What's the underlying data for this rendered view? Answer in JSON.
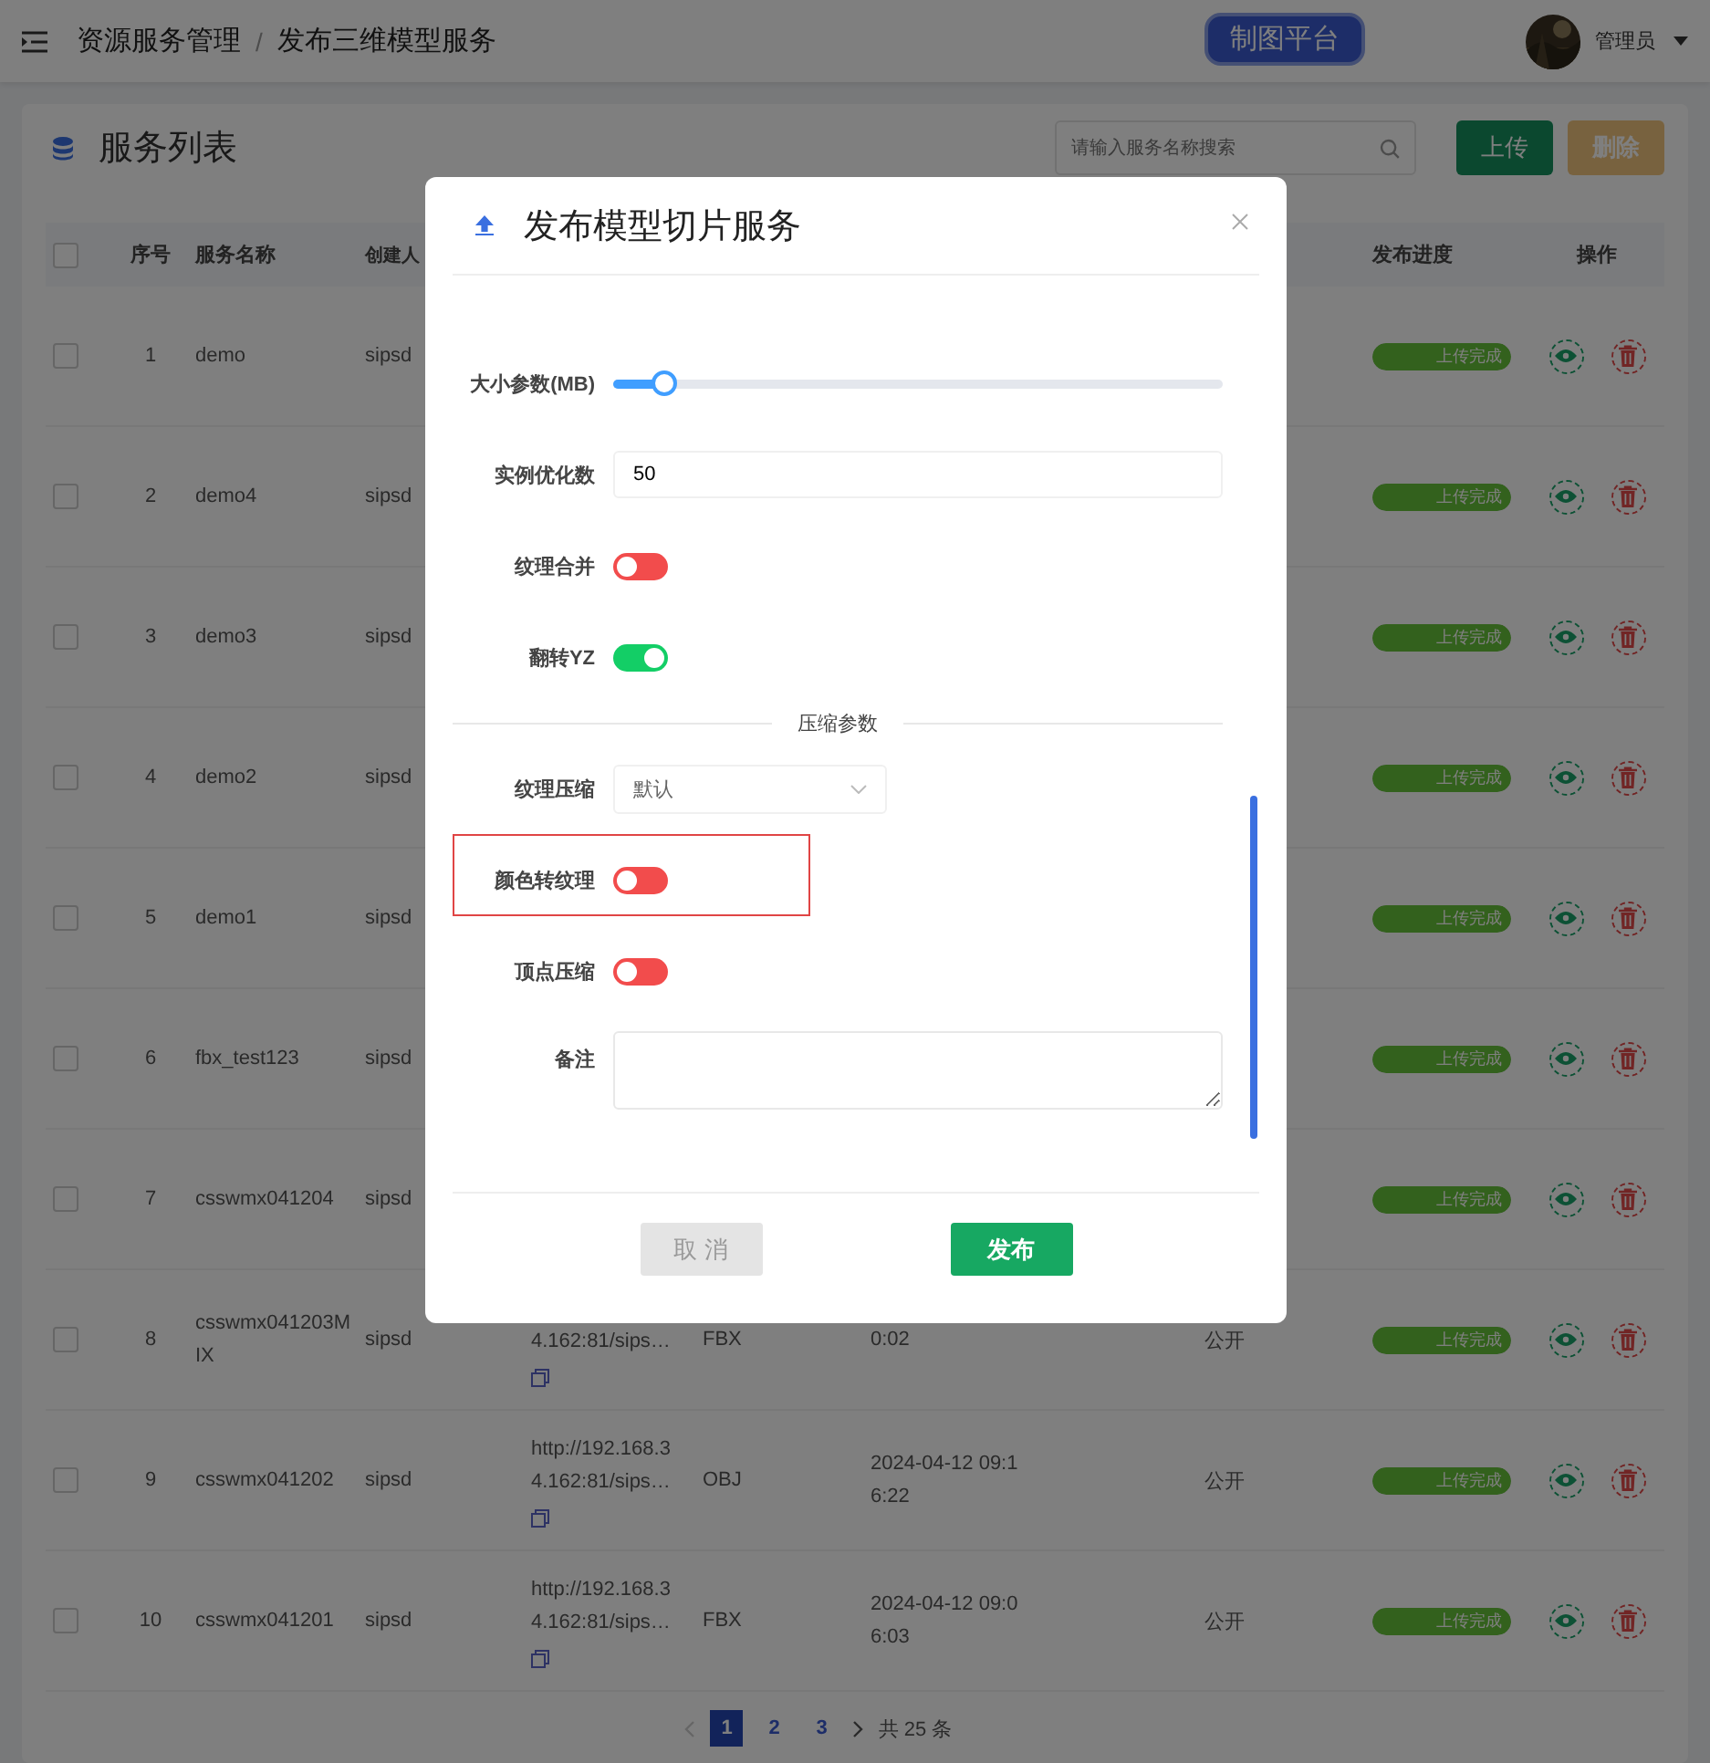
{
  "header": {
    "breadcrumb": [
      "资源服务管理",
      "发布三维模型服务"
    ],
    "separator": "/",
    "badge": "制图平台",
    "user": "管理员"
  },
  "list": {
    "title": "服务列表",
    "search": {
      "placeholder": "请输入服务名称搜索"
    },
    "buttons": [
      {
        "label": "上传",
        "disabled": false
      },
      {
        "label": "删除",
        "disabled": true
      }
    ],
    "select_all_checked": false,
    "headers_left": [
      "序号",
      "服务名称",
      "创建人"
    ],
    "headers_right": [
      "发布进度",
      "操作"
    ],
    "rows": [
      {
        "no": "1",
        "name": "demo",
        "creator": "sipsd",
        "checked": false,
        "progress": {
          "level": 1,
          "text": "上传完成"
        }
      },
      {
        "no": "2",
        "name": "demo4",
        "creator": "sipsd",
        "checked": false,
        "progress": {
          "level": 1,
          "text": "上传完成"
        }
      },
      {
        "no": "3",
        "name": "demo3",
        "creator": "sipsd",
        "checked": false,
        "progress": {
          "level": 1,
          "text": "上传完成"
        }
      },
      {
        "no": "4",
        "name": "demo2",
        "creator": "sipsd",
        "checked": false,
        "progress": {
          "level": 1,
          "text": "上传完成"
        }
      },
      {
        "no": "5",
        "name": "demo1",
        "creator": "sipsd",
        "checked": false,
        "progress": {
          "level": 1,
          "text": "上传完成"
        }
      },
      {
        "no": "6",
        "name": "fbx_test123",
        "creator": "sipsd",
        "checked": false,
        "progress": {
          "level": 1,
          "text": "上传完成"
        }
      },
      {
        "no": "7",
        "name": "csswmx041204",
        "creator": "sipsd",
        "checked": false,
        "progress": {
          "level": 1,
          "text": "上传完成"
        }
      },
      {
        "no": "8",
        "name": "csswmx041203MIX",
        "creator": "sipsd",
        "checked": false,
        "url": "4.162:81/sips…",
        "type": "FBX",
        "date": "0:02",
        "access": "公开",
        "progress": {
          "level": 1,
          "text": "上传完成"
        }
      },
      {
        "no": "9",
        "name": "csswmx041202",
        "creator": "sipsd",
        "checked": false,
        "url": "http://192.168.34.162:81/sips…",
        "type": "OBJ",
        "date": "2024-04-12 09:16:22",
        "access": "公开",
        "progress": {
          "level": 1,
          "text": "上传完成"
        }
      },
      {
        "no": "10",
        "name": "csswmx041201",
        "creator": "sipsd",
        "checked": false,
        "url": "http://192.168.34.162:81/sips…",
        "type": "FBX",
        "date": "2024-04-12 09:06:03",
        "access": "公开",
        "progress": {
          "level": 1,
          "text": "上传完成"
        }
      }
    ],
    "pagination": {
      "pages": [
        {
          "label": "1",
          "selected": true
        },
        {
          "label": "2",
          "selected": false
        },
        {
          "label": "3",
          "selected": false
        }
      ],
      "total": "共 25 条"
    }
  },
  "dialog": {
    "title": "发布模型切片服务",
    "fields": [
      {
        "kind": "slider",
        "label": "大小参数(MB)",
        "level": 0.08
      },
      {
        "kind": "input",
        "label": "实例优化数",
        "value": "50"
      },
      {
        "kind": "switch",
        "label": "纹理合并",
        "on": false
      },
      {
        "kind": "switch",
        "label": "翻转YZ",
        "on": true
      },
      {
        "kind": "divider",
        "label": "压缩参数"
      },
      {
        "kind": "select",
        "label": "纹理压缩",
        "value": "默认"
      },
      {
        "kind": "switch",
        "label": "颜色转纹理",
        "on": false,
        "highlighted": true
      },
      {
        "kind": "switch",
        "label": "顶点压缩",
        "on": false
      },
      {
        "kind": "textarea",
        "label": "备注"
      }
    ],
    "buttons": [
      {
        "label": "取 消",
        "disabled": true
      },
      {
        "label": "发布",
        "disabled": false
      }
    ]
  }
}
